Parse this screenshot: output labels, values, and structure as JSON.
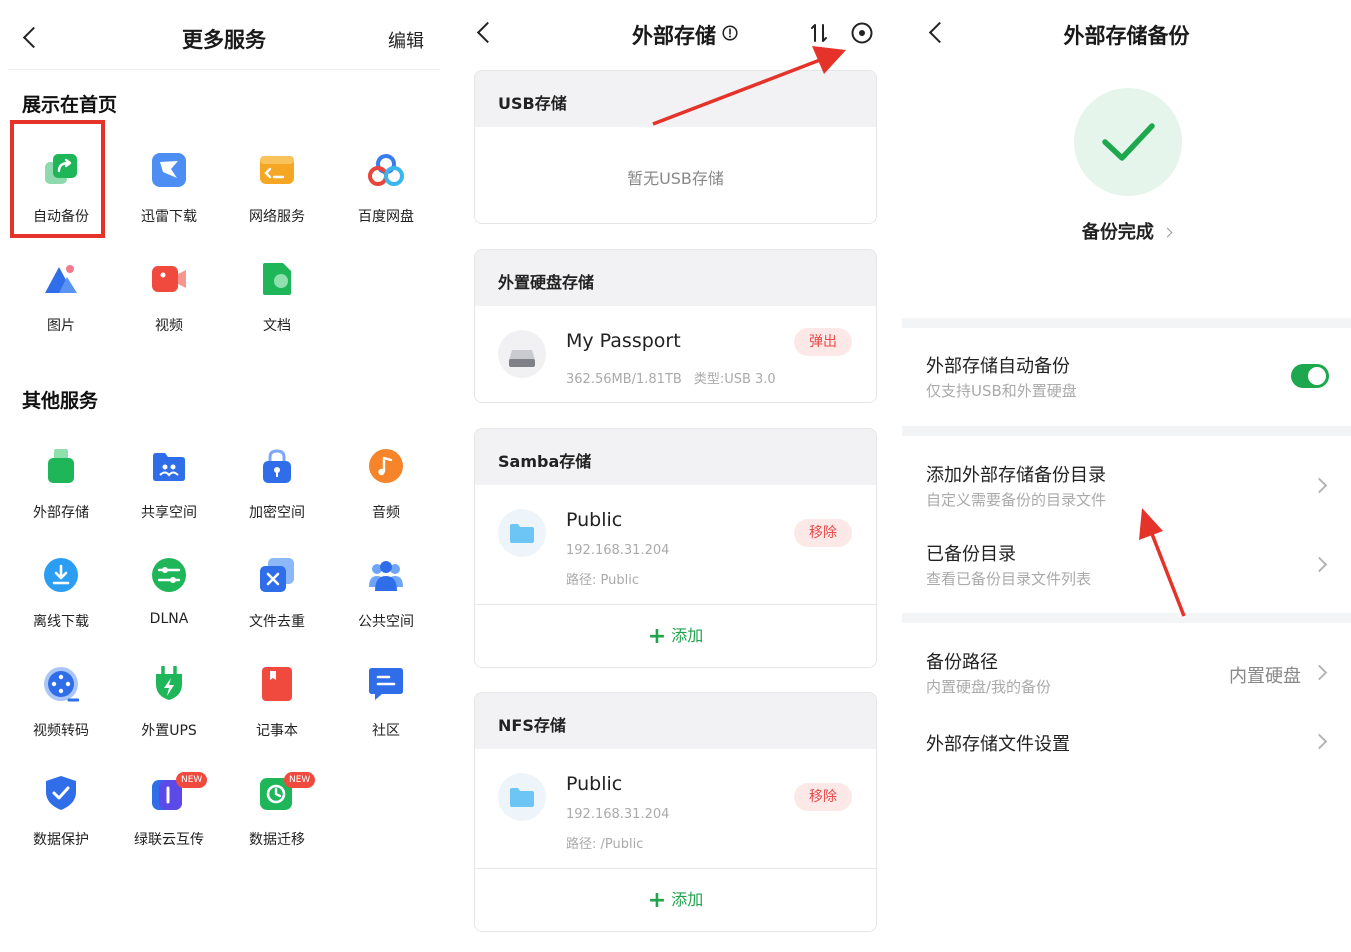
{
  "panel1": {
    "title": "更多服务",
    "edit_label": "编辑",
    "section_home": "展示在首页",
    "home_items": [
      {
        "label": "自动备份",
        "icon": "auto-backup-icon"
      },
      {
        "label": "迅雷下载",
        "icon": "xunlei-download-icon"
      },
      {
        "label": "网络服务",
        "icon": "network-service-icon"
      },
      {
        "label": "百度网盘",
        "icon": "baidu-netdisk-icon"
      },
      {
        "label": "图片",
        "icon": "photos-icon"
      },
      {
        "label": "视频",
        "icon": "video-icon"
      },
      {
        "label": "文档",
        "icon": "document-icon"
      }
    ],
    "section_other": "其他服务",
    "other_items": [
      {
        "label": "外部存储",
        "icon": "external-storage-icon"
      },
      {
        "label": "共享空间",
        "icon": "shared-space-icon"
      },
      {
        "label": "加密空间",
        "icon": "encrypted-space-icon"
      },
      {
        "label": "音频",
        "icon": "audio-icon"
      },
      {
        "label": "离线下载",
        "icon": "offline-download-icon"
      },
      {
        "label": "DLNA",
        "icon": "dlna-icon"
      },
      {
        "label": "文件去重",
        "icon": "file-dedup-icon"
      },
      {
        "label": "公共空间",
        "icon": "public-space-icon"
      },
      {
        "label": "视频转码",
        "icon": "video-transcode-icon"
      },
      {
        "label": "外置UPS",
        "icon": "external-ups-icon"
      },
      {
        "label": "记事本",
        "icon": "notepad-icon"
      },
      {
        "label": "社区",
        "icon": "community-icon"
      },
      {
        "label": "数据保护",
        "icon": "data-protection-icon"
      },
      {
        "label": "绿联云互传",
        "icon": "ugreen-transfer-icon",
        "badge": "NEW"
      },
      {
        "label": "数据迁移",
        "icon": "data-migration-icon",
        "badge": "NEW"
      }
    ]
  },
  "panel2": {
    "title": "外部存储",
    "usb": {
      "header": "USB存储",
      "empty": "暂无USB存储"
    },
    "hdd": {
      "header": "外置硬盘存储",
      "name": "My Passport",
      "size": "362.56MB/1.81TB",
      "type": "类型:USB 3.0",
      "action": "弹出"
    },
    "samba": {
      "header": "Samba存储",
      "name": "Public",
      "ip": "192.168.31.204",
      "path": "路径:  Public",
      "action": "移除",
      "add": "添加"
    },
    "nfs": {
      "header": "NFS存储",
      "name": "Public",
      "ip": "192.168.31.204",
      "path": "路径:  /Public",
      "action": "移除",
      "add": "添加"
    }
  },
  "panel3": {
    "title": "外部存储备份",
    "status": "备份完成",
    "auto_backup": {
      "title": "外部存储自动备份",
      "sub": "仅支持USB和外置硬盘",
      "enabled": true
    },
    "add_dir": {
      "title": "添加外部存储备份目录",
      "sub": "自定义需要备份的目录文件"
    },
    "backed_dir": {
      "title": "已备份目录",
      "sub": "查看已备份目录文件列表"
    },
    "backup_path": {
      "title": "备份路径",
      "sub": "内置硬盘/我的备份",
      "value": "内置硬盘"
    },
    "file_settings": {
      "title": "外部存储文件设置"
    }
  },
  "colors": {
    "accent_green": "#1da84e",
    "danger_red": "#e84a4a",
    "annotation_red": "#e5332a"
  }
}
